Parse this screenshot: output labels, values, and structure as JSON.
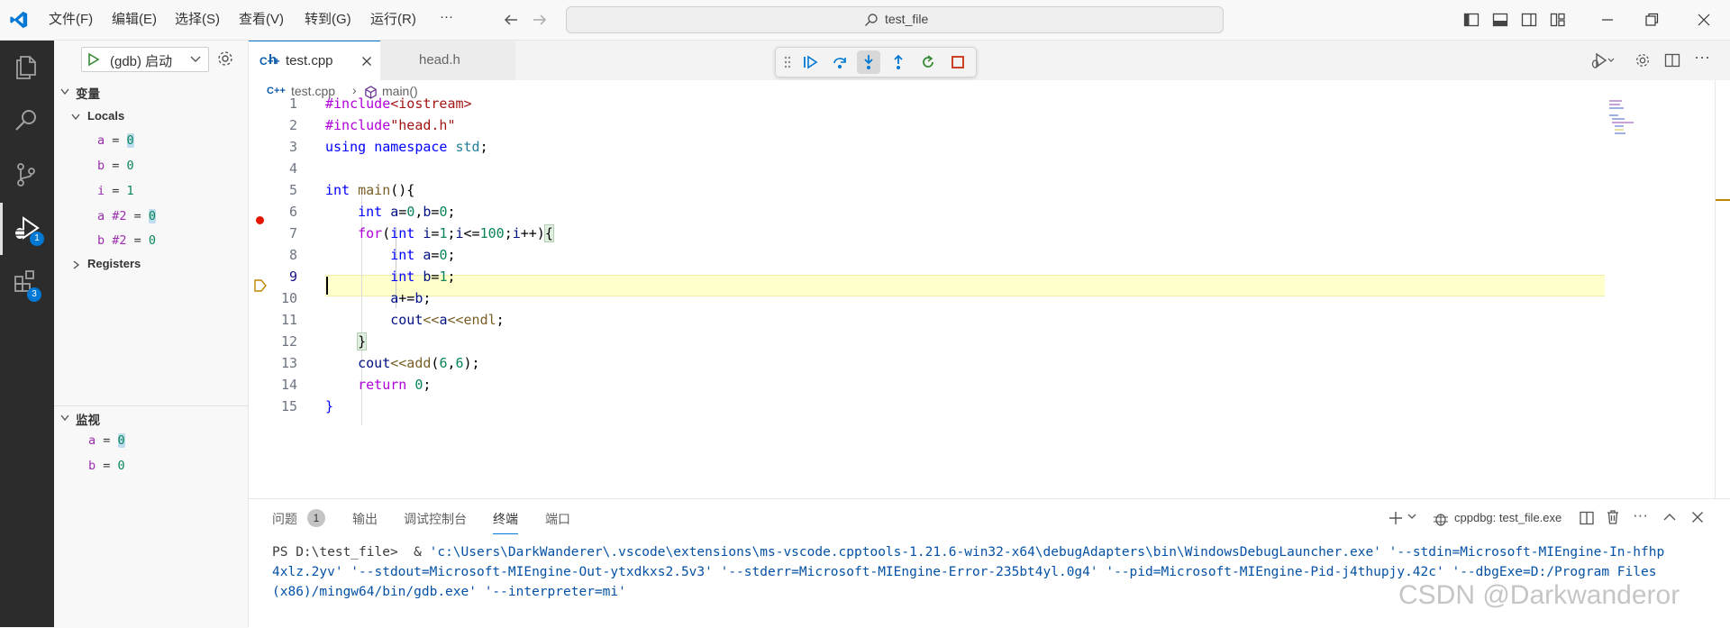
{
  "titlebar": {
    "menus": [
      "文件(F)",
      "编辑(E)",
      "选择(S)",
      "查看(V)",
      "转到(G)",
      "运行(R)",
      "···"
    ],
    "search_text": "test_file"
  },
  "activity": {
    "debug_badge": "1",
    "extensions_badge": "3"
  },
  "sidebar": {
    "run_config": "(gdb) 启动",
    "variables_title": "变量",
    "locals_title": "Locals",
    "locals": [
      {
        "name": "a",
        "value": "0"
      },
      {
        "name": "b",
        "value": "0"
      },
      {
        "name": "i",
        "value": "1"
      },
      {
        "name": "a #2",
        "value": "0"
      },
      {
        "name": "b #2",
        "value": "0"
      }
    ],
    "registers_title": "Registers",
    "watch_title": "监视",
    "watch": [
      {
        "name": "a",
        "value": "0"
      },
      {
        "name": "b",
        "value": "0"
      }
    ]
  },
  "tabs": [
    {
      "icon": "C++",
      "label": "test.cpp"
    },
    {
      "icon": "h",
      "label": "head.h"
    }
  ],
  "breadcrumb": {
    "file_icon": "C++",
    "file": "test.cpp",
    "symbol": "main()"
  },
  "code": {
    "line_numbers": [
      "1",
      "2",
      "3",
      "4",
      "5",
      "6",
      "7",
      "8",
      "9",
      "10",
      "11",
      "12",
      "13",
      "14",
      "15"
    ],
    "breakpoint_line": "6",
    "current_line": "9"
  },
  "panel": {
    "tabs": [
      "问题",
      "输出",
      "调试控制台",
      "终端",
      "端口"
    ],
    "problems_count": "1",
    "active_tab": "终端",
    "terminal_name": "cppdbg: test_file.exe",
    "terminal_prompt": "PS D:\\test_file>  & ",
    "terminal_line1_str": "'c:\\Users\\DarkWanderer\\.vscode\\extensions\\ms-vscode.cpptools-1.21.6-win32-x64\\debugAdapters\\bin\\WindowsDebugLauncher.exe' '--stdin=Microsoft-MIEngine-In-hfhp",
    "terminal_line2": "4xlz.2yv' '--stdout=Microsoft-MIEngine-Out-ytxdkxs2.5v3' '--stderr=Microsoft-MIEngine-Error-235bt4yl.0g4' '--pid=Microsoft-MIEngine-Pid-j4thupjy.42c' '--dbgExe=D:/Program Files",
    "terminal_line3": "(x86)/mingw64/bin/gdb.exe' '--interpreter=mi'"
  },
  "watermark": "CSDN @Darkwanderor"
}
